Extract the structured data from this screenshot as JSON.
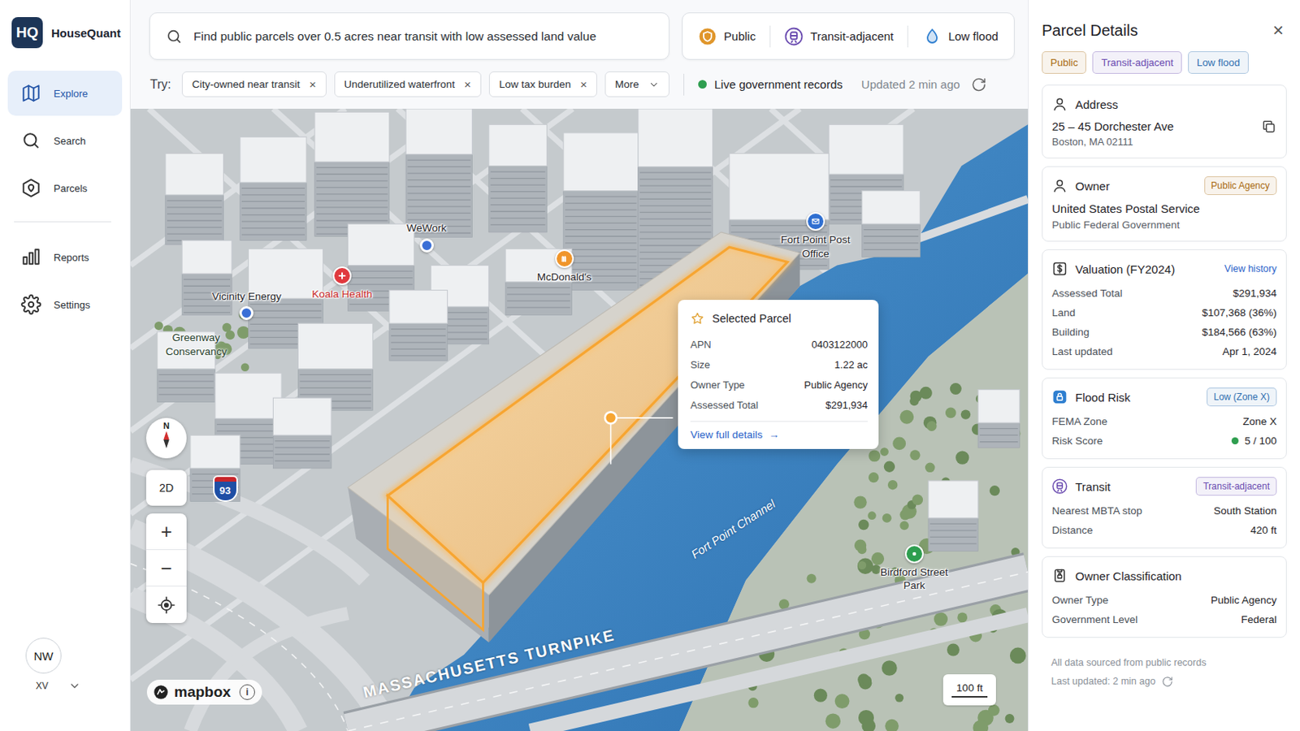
{
  "app": {
    "logo": "HQ",
    "name": "HouseQuant"
  },
  "sidebar": {
    "primary": [
      {
        "label": "Explore",
        "selected": true
      },
      {
        "label": "Search",
        "selected": false
      },
      {
        "label": "Parcels",
        "selected": false
      }
    ],
    "secondary": [
      {
        "label": "Reports",
        "selected": false
      },
      {
        "label": "Settings",
        "selected": false
      }
    ],
    "user": {
      "initials": "NW",
      "name": "XV"
    }
  },
  "search": {
    "value": "Find public parcels over 0.5 acres near transit with low assessed land value"
  },
  "filters": [
    {
      "label": "Public",
      "color": "#e0962b"
    },
    {
      "label": "Transit-adjacent",
      "color": "#6a4bb0"
    },
    {
      "label": "Low flood",
      "color": "#2f7fd0"
    }
  ],
  "suggestions": {
    "label": "Try:",
    "chips": [
      {
        "label": "City-owned near transit",
        "remove": "×"
      },
      {
        "label": "Underutilized waterfront",
        "remove": "×"
      },
      {
        "label": "Low tax burden",
        "remove": "×"
      }
    ],
    "more": "More"
  },
  "status": {
    "live": "Live government records",
    "live_color": "#2e9e4f",
    "updated": "Updated 2 min ago"
  },
  "map": {
    "pois": [
      {
        "label": "WeWork",
        "kind": "dot",
        "color": "#3a6fd6",
        "label_color": "#1f2328"
      },
      {
        "label": "Vicinity Energy",
        "kind": "dot",
        "color": "#3a6fd6",
        "label_color": "#1f2328"
      },
      {
        "label": "Koala Health",
        "kind": "badge",
        "color": "#e0393e",
        "label_color": "#c62828"
      },
      {
        "label": "McDonald's",
        "kind": "badge",
        "color": "#f0952a",
        "label_color": "#1f2328"
      },
      {
        "label": "Fort Point Post Office",
        "kind": "badge",
        "color": "#2f6fd1",
        "label_color": "#1f2328"
      },
      {
        "label": "Birdford Street Park",
        "kind": "badge",
        "color": "#2e9e4f",
        "label_color": "#1f2328"
      }
    ],
    "places": [
      {
        "label": "Greenway Conservancy",
        "kind": "district"
      },
      {
        "label": "Fort Point Channel",
        "kind": "water"
      },
      {
        "label": "MASSACHUSETTS TURNPIKE",
        "kind": "road"
      }
    ],
    "shield": "93",
    "compass": "N",
    "view": "2D",
    "zoom_in": "+",
    "zoom_out": "−",
    "attribution": "mapbox",
    "info": "i",
    "scale": "100 ft",
    "popup": {
      "title": "Selected Parcel",
      "rows": [
        {
          "label": "APN",
          "value": "0403122000"
        },
        {
          "label": "Size",
          "value": "1.22 ac"
        },
        {
          "label": "Owner Type",
          "value": "Public Agency"
        },
        {
          "label": "Assessed Total",
          "value": "$291,934"
        }
      ],
      "link": "View full details",
      "arrow": "→"
    }
  },
  "panel": {
    "title": "Parcel Details",
    "close": "×",
    "tags": [
      {
        "label": "Public",
        "color": "#a86a10"
      },
      {
        "label": "Transit-adjacent",
        "color": "#6a4bb0"
      },
      {
        "label": "Low flood",
        "color": "#2f6fb0"
      }
    ],
    "address": {
      "title": "Address",
      "line1": "25 – 45 Dorchester Ave",
      "line2": "Boston, MA 02111"
    },
    "owner": {
      "title": "Owner",
      "badge": {
        "label": "Public Agency",
        "color": "#a86a10"
      },
      "name": "United States Postal Service",
      "type": "Public Federal Government"
    },
    "valuation": {
      "title": "Valuation (FY2024)",
      "link": "View history",
      "rows": [
        {
          "label": "Assessed Total",
          "value": "$291,934"
        },
        {
          "label": "Land",
          "value": "$107,368 (36%)"
        },
        {
          "label": "Building",
          "value": "$184,566 (63%)"
        },
        {
          "label": "Last updated",
          "value": "Apr 1, 2024"
        }
      ]
    },
    "flood": {
      "title": "Flood Risk",
      "badge": {
        "label": "Low (Zone X)",
        "color": "#2f6fb0"
      },
      "rows": [
        {
          "label": "FEMA Zone",
          "value": "Zone X"
        },
        {
          "label": "Risk Score",
          "value": "5 / 100",
          "color": "#2e9e4f"
        }
      ]
    },
    "transit": {
      "title": "Transit",
      "badge": {
        "label": "Transit-adjacent",
        "color": "#6a4bb0"
      },
      "rows": [
        {
          "label": "Nearest MBTA stop",
          "value": "South Station"
        },
        {
          "label": "Distance",
          "value": "420 ft"
        }
      ]
    },
    "classification": {
      "title": "Owner Classification",
      "rows": [
        {
          "label": "Owner Type",
          "value": "Public Agency"
        },
        {
          "label": "Government Level",
          "value": "Federal"
        }
      ]
    },
    "footer": {
      "source": "All data sourced from public records",
      "updated": "Last updated: 2 min ago"
    }
  }
}
